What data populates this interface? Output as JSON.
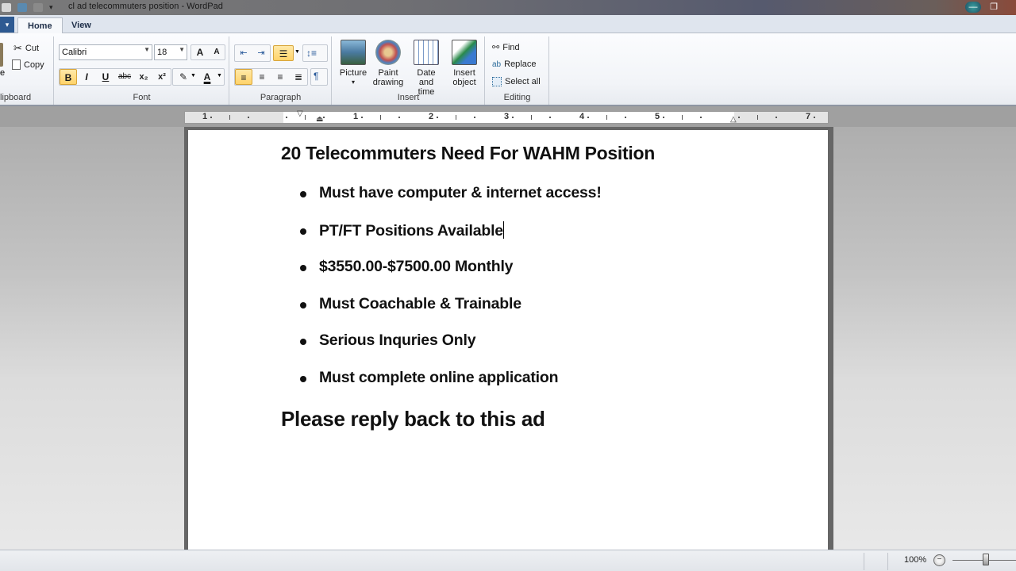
{
  "window": {
    "title": "cl ad telecommuters position - WordPad",
    "minimize_label": "—",
    "restore_label": "❐"
  },
  "tabs": [
    {
      "label": "Home",
      "active": true
    },
    {
      "label": "View",
      "active": false
    }
  ],
  "app_menu_label": "▾",
  "ribbon": {
    "clipboard": {
      "label": "Clipboard",
      "label_visible": "lipboard",
      "paste_label": "e",
      "cut_label": "Cut",
      "copy_label": "Copy"
    },
    "font": {
      "label": "Font",
      "family": "Calibri",
      "size": "18",
      "grow_label": "A",
      "shrink_label": "A",
      "bold_label": "B",
      "italic_label": "I",
      "underline_label": "U",
      "strike_label": "abc",
      "subscript_label": "x₂",
      "superscript_label": "x²",
      "highlight_label": "✎",
      "color_label": "A",
      "bold_active": true
    },
    "paragraph": {
      "label": "Paragraph",
      "list_active": true,
      "align_left_active": true
    },
    "insert": {
      "label": "Insert",
      "picture_label": "Picture",
      "picture_sub": "▾",
      "paint_label_1": "Paint",
      "paint_label_2": "drawing",
      "datetime_label_1": "Date and",
      "datetime_label_2": "time",
      "object_label_1": "Insert",
      "object_label_2": "object"
    },
    "editing": {
      "label": "Editing",
      "find_label": "Find",
      "replace_label": "Replace",
      "select_all_label": "Select all"
    }
  },
  "ruler": {
    "numbers": [
      "1",
      "1",
      "2",
      "3",
      "4",
      "5",
      "7"
    ]
  },
  "document": {
    "title": "20 Telecommuters Need For WAHM Position",
    "bullets": [
      "Must have computer & internet access!",
      "PT/FT Positions Available",
      "$3550.00-$7500.00 Monthly",
      "Must Coachable & Trainable",
      "Serious Inquries Only",
      "Must complete online application"
    ],
    "caret_after_bullet_index": 1,
    "footer": "Please reply back to this ad"
  },
  "statusbar": {
    "zoom_label": "100%",
    "zoom_out_label": "−",
    "zoom_percent": 100
  },
  "colors": {
    "active_button": "#ffd36a",
    "ribbon_bg": "#f2f4f8",
    "app_menu": "#2e5a92"
  }
}
